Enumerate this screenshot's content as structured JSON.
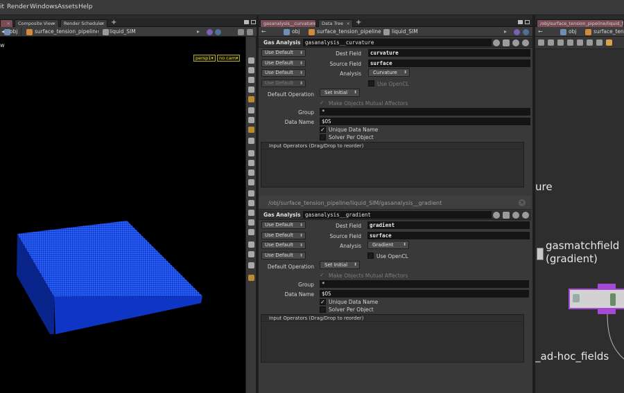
{
  "menubar": [
    "it",
    "Render",
    "Windows",
    "Assets",
    "Help"
  ],
  "left_pane": {
    "tabs": [
      "Composite View",
      "Render Scheduler"
    ],
    "path": [
      "obj",
      "surface_tension_pipeline",
      "liquid_SIM"
    ],
    "viewport_label": "w",
    "view_menu": "persp1",
    "cam_menu": "no cam"
  },
  "mid_pane": {
    "tabs": [
      "gasanalysis__curvature",
      "Data Tree"
    ],
    "path": [
      "obj",
      "surface_tension_pipeline",
      "liquid_SIM"
    ]
  },
  "right_pane": {
    "tab": "/obj/surface_tension_pipeline/liquid_SIM",
    "path": [
      "obj",
      "surface_tension"
    ],
    "network_texts": [
      "ure",
      "gasmatchfield",
      "(gradient)",
      "_ad-hoc_fields"
    ]
  },
  "node1": {
    "type": "Gas Analysis",
    "name": "gasanalysis__curvature",
    "use_default": "Use Default",
    "dest_field_label": "Dest Field",
    "dest_field": "curvature",
    "source_field_label": "Source Field",
    "source_field": "surface",
    "analysis_label": "Analysis",
    "analysis": "Curvature",
    "use_opencl": "Use OpenCL",
    "default_operation_label": "Default Operation",
    "default_operation": "Set Initial",
    "make_mutual": "Make Objects Mutual Affectors",
    "group_label": "Group",
    "group": "*",
    "data_name_label": "Data Name",
    "data_name": "$OS",
    "unique_data_name": "Unique Data Name",
    "solver_per_object": "Solver Per Object",
    "input_operators": "Input Operators (Drag/Drop to reorder)"
  },
  "floating_window": {
    "path": "/obj/surface_tension_pipeline/liquid_SIM/gasanalysis__gradient"
  },
  "node2": {
    "type": "Gas Analysis",
    "name": "gasanalysis__gradient",
    "use_default": "Use Default",
    "dest_field_label": "Dest Field",
    "dest_field": "gradient",
    "source_field_label": "Source Field",
    "source_field": "surface",
    "analysis_label": "Analysis",
    "analysis": "Gradient",
    "use_opencl": "Use OpenCL",
    "default_operation_label": "Default Operation",
    "default_operation": "Set Initial",
    "make_mutual": "Make Objects Mutual Affectors",
    "group_label": "Group",
    "group": "*",
    "data_name_label": "Data Name",
    "data_name": "$OS",
    "unique_data_name": "Unique Data Name",
    "solver_per_object": "Solver Per Object",
    "input_operators": "Input Operators (Drag/Drop to reorder)"
  },
  "colors": {
    "accent_tab": "#7a4d55",
    "particles": "#1e5bff",
    "node_purple": "#a64ad6",
    "viewport_tag": "#e2d64a"
  }
}
